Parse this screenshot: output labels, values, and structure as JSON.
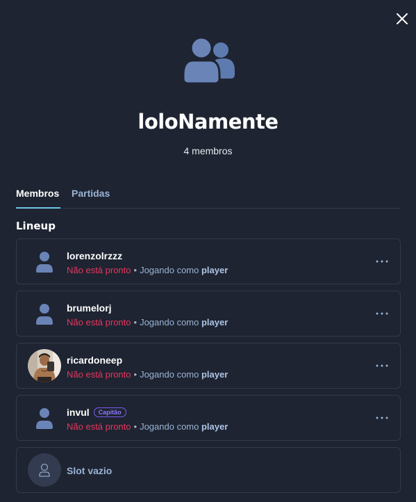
{
  "team": {
    "name": "loloNamente",
    "member_count": "4 membros"
  },
  "tabs": [
    {
      "label": "Membros",
      "active": true
    },
    {
      "label": "Partidas",
      "active": false
    }
  ],
  "lineup": {
    "title": "Lineup",
    "members": [
      {
        "name": "lorenzolrzzz",
        "avatar": "default-user-icon",
        "status": "Não está pronto",
        "playing_as": "Jogando como",
        "role": "player"
      },
      {
        "name": "brumelorj",
        "avatar": "default-user-icon",
        "status": "Não está pronto",
        "playing_as": "Jogando como",
        "role": "player"
      },
      {
        "name": "ricardoneep",
        "avatar": "profile-photo",
        "status": "Não está pronto",
        "playing_as": "Jogando como",
        "role": "player"
      },
      {
        "name": "invul",
        "avatar": "default-user-icon",
        "badge": "Capitão",
        "status": "Não está pronto",
        "playing_as": "Jogando como",
        "role": "player"
      }
    ],
    "empty_slot": {
      "label": "Slot vazio"
    }
  },
  "colors": {
    "background": "#1e2431",
    "card_border": "#323a4a",
    "accent_tab": "#6ec6e6",
    "not_ready": "#e8355f",
    "muted": "#9bb3d6",
    "captain": "#8f74ff"
  }
}
